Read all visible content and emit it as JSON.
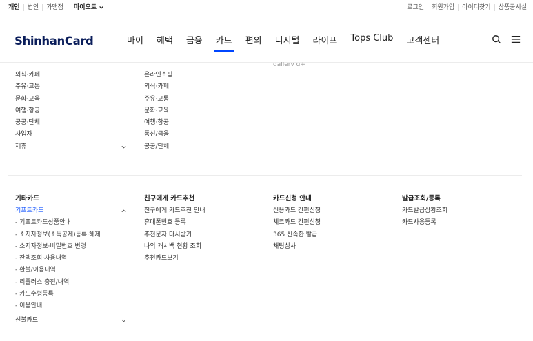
{
  "util": {
    "left": [
      "개인",
      "법인",
      "가맹점"
    ],
    "myolle": "마이오토",
    "right": [
      "로그인",
      "회원가입",
      "아이디찾기",
      "상품공시실"
    ]
  },
  "logo": "ShinhanCard",
  "menu": [
    "마이",
    "혜택",
    "금융",
    "카드",
    "편의",
    "디지털",
    "라이프",
    "Tops Club",
    "고객센터"
  ],
  "active_menu": "카드",
  "col1_top": [
    "외식·카페",
    "주유·교통",
    "문화·교육",
    "여행·항공",
    "공공·단체",
    "사업자",
    "제휴"
  ],
  "col2_top": [
    "온라인쇼핑",
    "외식·카페",
    "주유·교통",
    "문화·교육",
    "여행·항공",
    "통신/금융",
    "공공/단체"
  ],
  "col3_top_partial": "gallery g+",
  "sections": {
    "etc": {
      "title": "기타카드",
      "items": [
        "기프트카드"
      ],
      "subitems": [
        "- 기프트카드상품안내",
        "- 소지자정보(소득공제)등록·해제",
        "- 소지자정보·비밀번호 변경",
        "- 잔액조회·사용내역",
        "- 환불/이용내역",
        "- 리플러스 충전/내역",
        "- 카드수령등록",
        "- 이용안내"
      ],
      "last": "선불카드"
    },
    "friend": {
      "title": "친구에게 카드추천",
      "items": [
        "친구에게 카드추천 안내",
        "휴대폰번호 등록",
        "추천문자 다시받기",
        "나의 캐시백 현황 조회",
        "추천카드보기"
      ]
    },
    "apply": {
      "title": "카드신청 안내",
      "items": [
        "신용카드 간편신청",
        "체크카드 간편신청",
        "365 신속한 발급",
        "채팅심사"
      ]
    },
    "issue": {
      "title": "발급조회/등록",
      "items": [
        "카드발급상황조회",
        "카드사용등록"
      ]
    }
  },
  "colors": {
    "accent": "#0046ff",
    "link": "#1a5aff",
    "logo": "#0b1e5b"
  }
}
